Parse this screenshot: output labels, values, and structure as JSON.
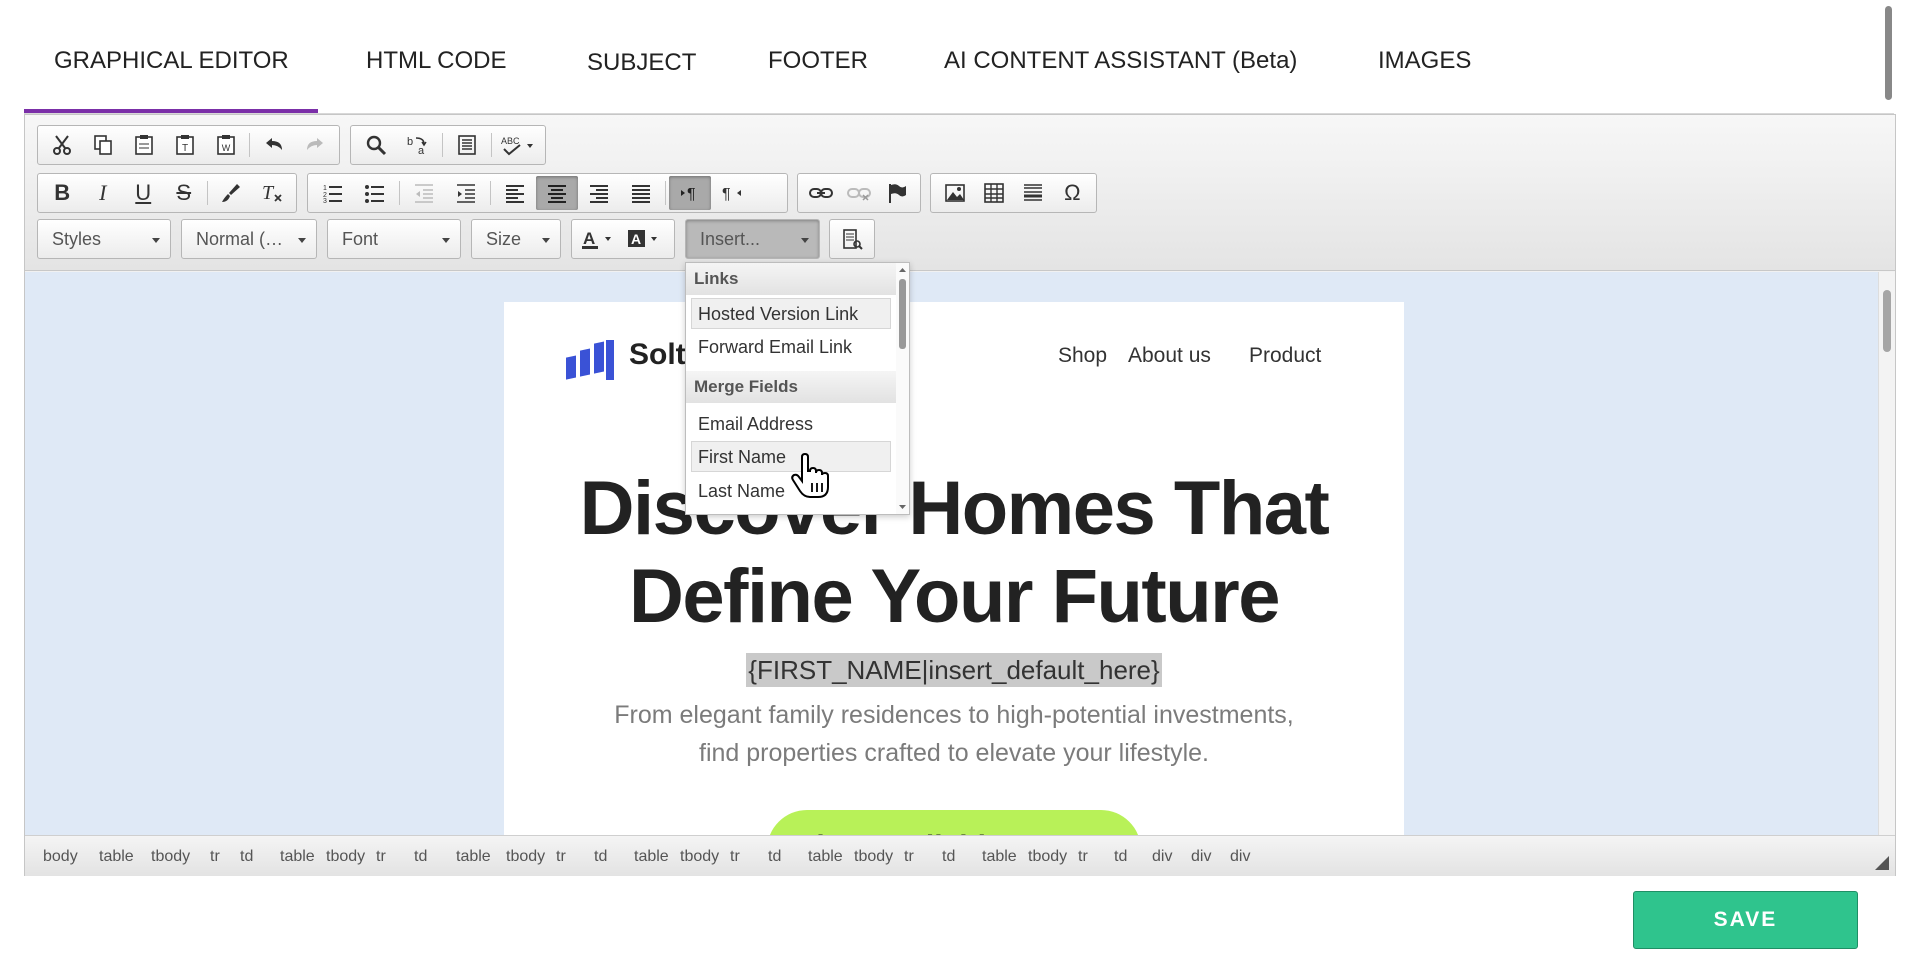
{
  "tabs": [
    {
      "label": "GRAPHICAL EDITOR",
      "active": true
    },
    {
      "label": "HTML CODE"
    },
    {
      "label": "SUBJECT"
    },
    {
      "label": "FOOTER"
    },
    {
      "label": "AI CONTENT ASSISTANT (Beta)"
    },
    {
      "label": "IMAGES"
    }
  ],
  "accent_color": "#7b2fa8",
  "toolbar": {
    "combos": {
      "styles": "Styles",
      "format": "Normal (…",
      "font": "Font",
      "size": "Size",
      "insert": "Insert..."
    },
    "icons": {
      "color": "A",
      "background_color": "A",
      "omega": "Ω"
    },
    "active_buttons": [
      "align-center",
      "ltr"
    ]
  },
  "dropdown": {
    "sections": [
      {
        "title": "Links",
        "items": [
          "Hosted Version Link",
          "Forward Email Link"
        ]
      },
      {
        "title": "Merge Fields",
        "items": [
          "Email Address",
          "First Name",
          "Last Name"
        ]
      }
    ],
    "highlighted": [
      "Hosted Version Link",
      "First Name"
    ]
  },
  "email": {
    "brand": "Solt",
    "nav": [
      "Shop",
      "About us",
      "Product"
    ],
    "headline_line1": "Discover Homes That",
    "headline_line2": "Define Your Future",
    "merge_tag": "{FIRST_NAME|insert_default_here}",
    "body_line1": "From elegant family residences to high-potential investments,",
    "body_line2": "find properties crafted to elevate your lifestyle.",
    "cta": "View Available Homes",
    "cta_color": "#b8f158",
    "background_color": "#dfe9f6"
  },
  "path": [
    "body",
    "table",
    "tbody",
    "tr",
    "td",
    "table",
    "tbody",
    "tr",
    "td",
    "table",
    "tbody",
    "tr",
    "td",
    "table",
    "tbody",
    "tr",
    "td",
    "table",
    "tbody",
    "tr",
    "td",
    "table",
    "tbody",
    "tr",
    "td",
    "div",
    "div",
    "div"
  ],
  "save_label": "SAVE",
  "save_color": "#2fc48d"
}
